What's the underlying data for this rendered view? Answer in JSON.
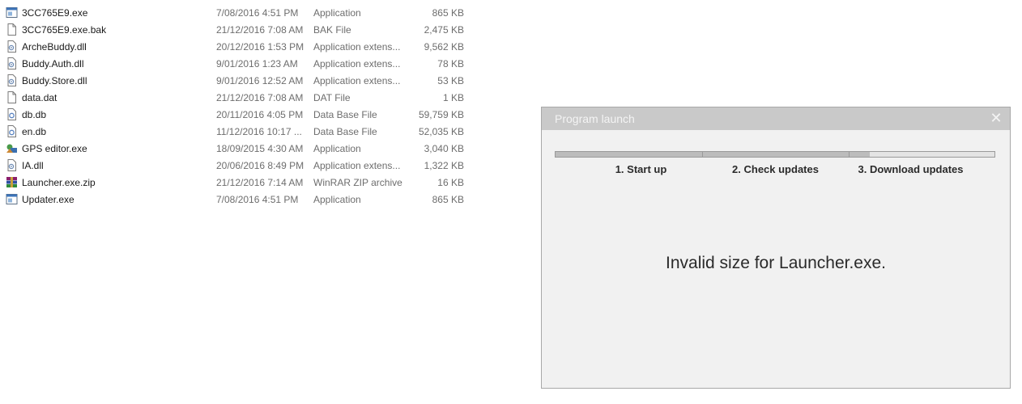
{
  "explorer": {
    "files": [
      {
        "name": "3CC765E9.exe",
        "date": "7/08/2016 4:51 PM",
        "type": "Application",
        "size": "865 KB",
        "icon": "exe-icon"
      },
      {
        "name": "3CC765E9.exe.bak",
        "date": "21/12/2016 7:08 AM",
        "type": "BAK File",
        "size": "2,475 KB",
        "icon": "file-icon"
      },
      {
        "name": "ArcheBuddy.dll",
        "date": "20/12/2016 1:53 PM",
        "type": "Application extens...",
        "size": "9,562 KB",
        "icon": "dll-icon"
      },
      {
        "name": "Buddy.Auth.dll",
        "date": "9/01/2016 1:23 AM",
        "type": "Application extens...",
        "size": "78 KB",
        "icon": "dll-icon"
      },
      {
        "name": "Buddy.Store.dll",
        "date": "9/01/2016 12:52 AM",
        "type": "Application extens...",
        "size": "53 KB",
        "icon": "dll-icon"
      },
      {
        "name": "data.dat",
        "date": "21/12/2016 7:08 AM",
        "type": "DAT File",
        "size": "1 KB",
        "icon": "file-icon"
      },
      {
        "name": "db.db",
        "date": "20/11/2016 4:05 PM",
        "type": "Data Base File",
        "size": "59,759 KB",
        "icon": "database-icon"
      },
      {
        "name": "en.db",
        "date": "11/12/2016 10:17 ...",
        "type": "Data Base File",
        "size": "52,035 KB",
        "icon": "database-icon"
      },
      {
        "name": "GPS editor.exe",
        "date": "18/09/2015 4:30 AM",
        "type": "Application",
        "size": "3,040 KB",
        "icon": "gps-app-icon"
      },
      {
        "name": "IA.dll",
        "date": "20/06/2016 8:49 PM",
        "type": "Application extens...",
        "size": "1,322 KB",
        "icon": "dll-icon"
      },
      {
        "name": "Launcher.exe.zip",
        "date": "21/12/2016 7:14 AM",
        "type": "WinRAR ZIP archive",
        "size": "16 KB",
        "icon": "winrar-archive-icon"
      },
      {
        "name": "Updater.exe",
        "date": "7/08/2016 4:51 PM",
        "type": "Application",
        "size": "865 KB",
        "icon": "exe-icon"
      }
    ]
  },
  "dialog": {
    "title": "Program launch",
    "close_glyph": "✕",
    "progress_fraction": 0.715,
    "steps": [
      "1. Start up",
      "2. Check updates",
      "3. Download updates"
    ],
    "message": "Invalid size for Launcher.exe."
  }
}
